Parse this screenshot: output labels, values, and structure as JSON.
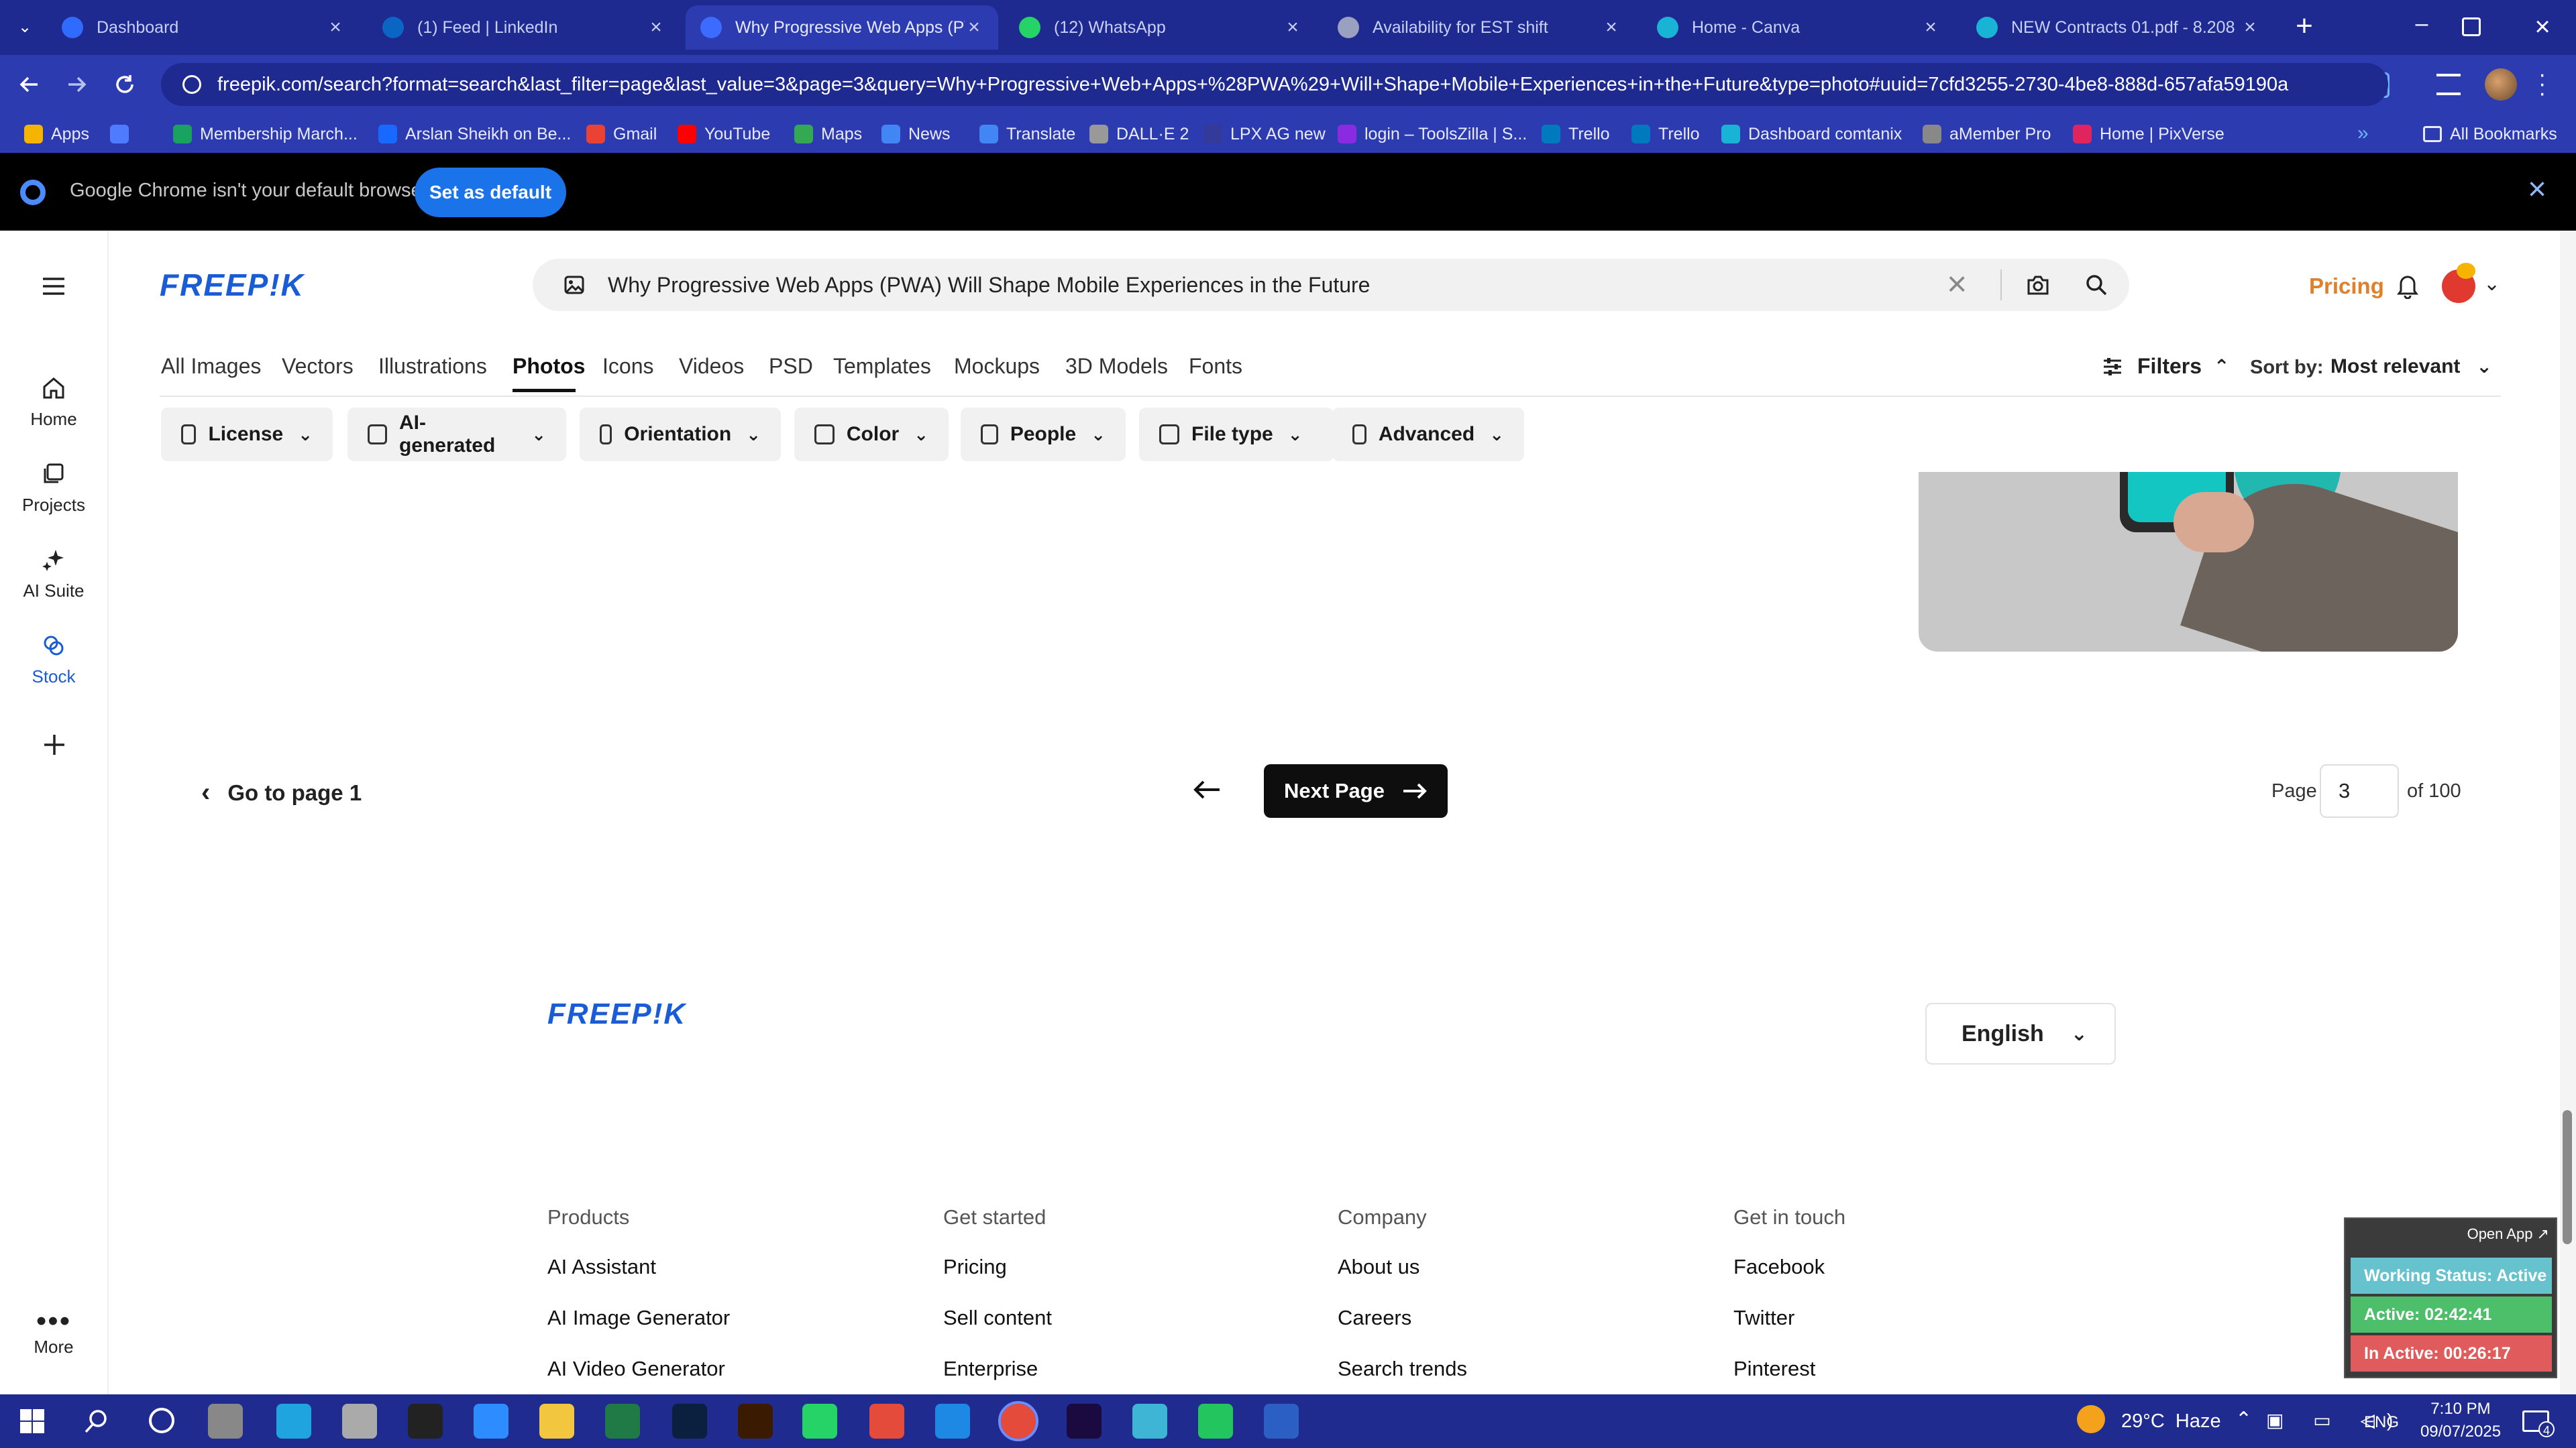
{
  "tabs": [
    {
      "title": "Dashboard",
      "color": "#2f6bff",
      "active": false
    },
    {
      "title": "(1) Feed | LinkedIn",
      "color": "#0a66c2",
      "active": false
    },
    {
      "title": "Why Progressive Web Apps (P\\",
      "color": "#3b6cff",
      "active": true
    },
    {
      "title": "(12) WhatsApp",
      "color": "#25d366",
      "active": false
    },
    {
      "title": "Availability for EST shift",
      "color": "#9aa0c0",
      "active": false
    },
    {
      "title": "Home - Canva",
      "color": "#19b3d6",
      "active": false
    },
    {
      "title": "NEW Contracts 01.pdf - 8.208",
      "color": "#19b3d6",
      "active": false
    }
  ],
  "url": "freepik.com/search?format=search&last_filter=page&last_value=3&page=3&query=Why+Progressive+Web+Apps+%28PWA%29+Will+Shape+Mobile+Experiences+in+the+Future&type=photo#uuid=7cfd3255-2730-4be8-888d-657afa59190a",
  "bookmarks": [
    {
      "label": "Apps",
      "color": "#f4b400"
    },
    {
      "label": "",
      "color": "#4f7cff"
    },
    {
      "label": "Membership March...",
      "color": "#1aa260"
    },
    {
      "label": "Arslan Sheikh on Be...",
      "color": "#1769ff"
    },
    {
      "label": "Gmail",
      "color": "#ea4335"
    },
    {
      "label": "YouTube",
      "color": "#ff0000"
    },
    {
      "label": "Maps",
      "color": "#34a853"
    },
    {
      "label": "News",
      "color": "#4285f4"
    },
    {
      "label": "Translate",
      "color": "#4285f4"
    },
    {
      "label": "DALL·E 2",
      "color": "#999999"
    },
    {
      "label": "LPX AG new",
      "color": "#333a99"
    },
    {
      "label": "login – ToolsZilla | S...",
      "color": "#8a2be2"
    },
    {
      "label": "Trello",
      "color": "#0079bf"
    },
    {
      "label": "Trello",
      "color": "#0079bf"
    },
    {
      "label": "Dashboard comtanix",
      "color": "#19b3d6"
    },
    {
      "label": "aMember Pro",
      "color": "#888888"
    },
    {
      "label": "Home | PixVerse",
      "color": "#e0245e"
    }
  ],
  "all_bookmarks": "All Bookmarks",
  "infobar": {
    "message": "Google Chrome isn't your default browser",
    "button": "Set as default"
  },
  "sidebar": {
    "items": [
      {
        "label": "Home"
      },
      {
        "label": "Projects"
      },
      {
        "label": "AI Suite"
      },
      {
        "label": "Stock"
      }
    ],
    "more": "More"
  },
  "brand": "FREEP!K",
  "search": {
    "query": "Why Progressive Web Apps (PWA) Will Shape Mobile Experiences in the Future"
  },
  "header": {
    "pricing": "Pricing"
  },
  "categories": [
    "All Images",
    "Vectors",
    "Illustrations",
    "Photos",
    "Icons",
    "Videos",
    "PSD",
    "Templates",
    "Mockups",
    "3D Models",
    "Fonts"
  ],
  "active_category": "Photos",
  "filters_label": "Filters",
  "sort": {
    "label": "Sort by:",
    "value": "Most relevant"
  },
  "filters": [
    "License",
    "AI-generated",
    "Orientation",
    "Color",
    "People",
    "File type",
    "Advanced"
  ],
  "pagination": {
    "go_first": "Go to page 1",
    "next": "Next Page",
    "page_label": "Page",
    "current": "3",
    "of_label": "of 100"
  },
  "footer": {
    "language": "English",
    "columns": [
      {
        "heading": "Products",
        "links": [
          "AI Assistant",
          "AI Image Generator",
          "AI Video Generator"
        ]
      },
      {
        "heading": "Get started",
        "links": [
          "Pricing",
          "Sell content",
          "Enterprise"
        ]
      },
      {
        "heading": "Company",
        "links": [
          "About us",
          "Careers",
          "Search trends"
        ]
      },
      {
        "heading": "Get in touch",
        "links": [
          "Facebook",
          "Twitter",
          "Pinterest"
        ]
      }
    ]
  },
  "widget": {
    "open_app": "Open App ↗",
    "status": "Working Status: Active",
    "active": "Active: 02:42:41",
    "inactive": "In Active: 00:26:17"
  },
  "taskbar": {
    "weather": "29°C  Haze",
    "lang": "ENG",
    "time": "7:10 PM",
    "date": "09/07/2025",
    "notifications": "4"
  }
}
